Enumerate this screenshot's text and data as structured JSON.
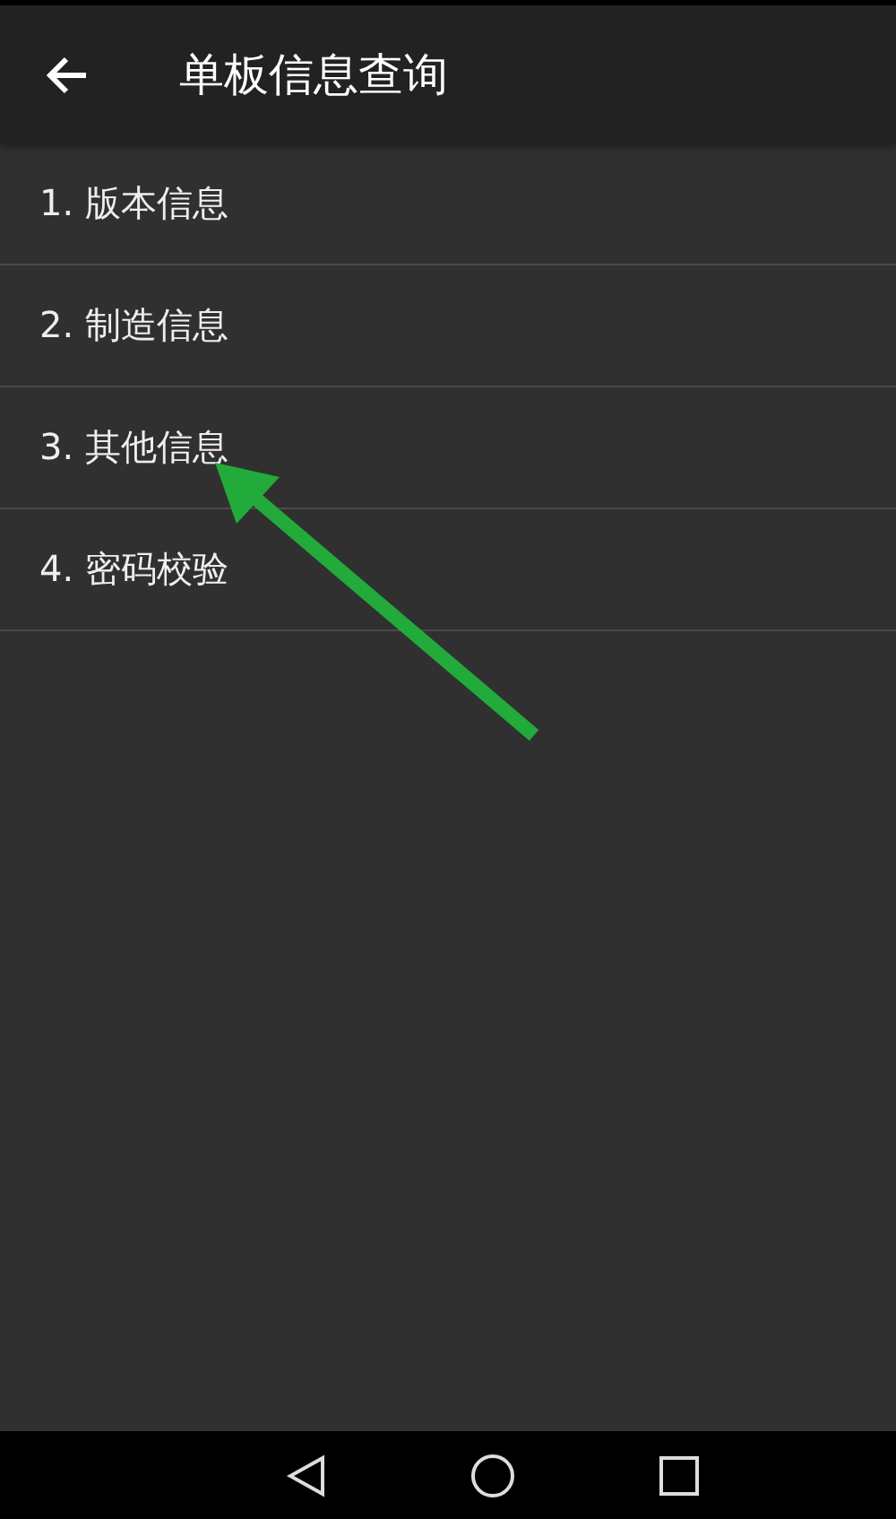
{
  "toolbar": {
    "title": "单板信息查询"
  },
  "menu_items": [
    {
      "label": "1. 版本信息"
    },
    {
      "label": "2. 制造信息"
    },
    {
      "label": "3. 其他信息"
    },
    {
      "label": "4. 密码校验"
    }
  ]
}
